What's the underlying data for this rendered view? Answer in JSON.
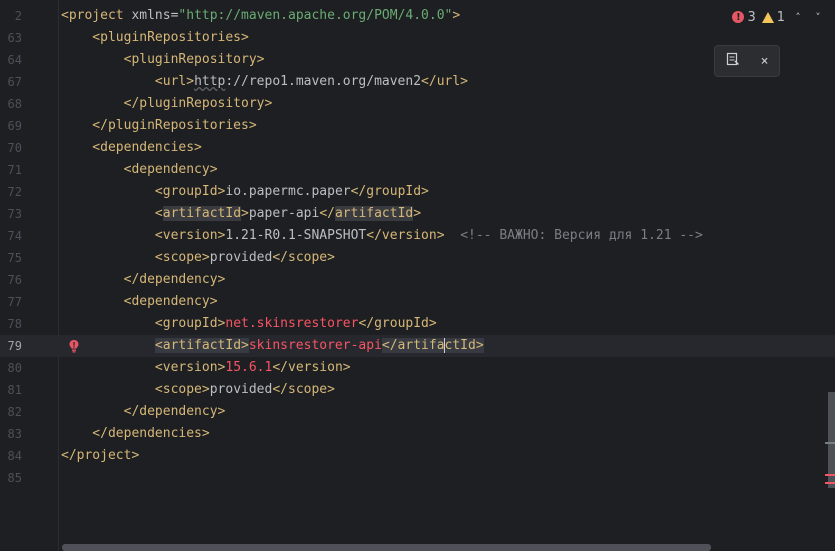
{
  "inspections": {
    "errors": "3",
    "warnings": "1",
    "prev": "˄",
    "next": "˅"
  },
  "popup": {
    "reader_icon": "reader-mode-icon",
    "close": "×"
  },
  "colors": {
    "tag": "#d5b778",
    "string": "#6aab73",
    "comment": "#7a7e85",
    "error": "#f75464"
  },
  "lines": [
    {
      "num": "2",
      "tokens": [
        {
          "t": "<project ",
          "c": "tag"
        },
        {
          "t": "xmlns",
          "c": "attr"
        },
        {
          "t": "=",
          "c": "text"
        },
        {
          "t": "\"http://maven.apache.org/POM/4.0.0\"",
          "c": "str"
        },
        {
          "t": ">",
          "c": "tag"
        }
      ]
    },
    {
      "num": "63",
      "tokens": [
        {
          "t": "    <pluginRepositories>",
          "c": "tag"
        }
      ]
    },
    {
      "num": "64",
      "tokens": [
        {
          "t": "        <pluginRepository>",
          "c": "tag"
        }
      ]
    },
    {
      "num": "67",
      "tokens": [
        {
          "t": "            ",
          "c": "text"
        },
        {
          "t": "<url>",
          "c": "tag"
        },
        {
          "t": "http",
          "c": "text",
          "squig": true
        },
        {
          "t": "://repo1.maven.org/maven2",
          "c": "text"
        },
        {
          "t": "</url>",
          "c": "tag"
        }
      ]
    },
    {
      "num": "68",
      "tokens": [
        {
          "t": "        </pluginRepository>",
          "c": "tag"
        }
      ]
    },
    {
      "num": "69",
      "tokens": [
        {
          "t": "    </pluginRepositories>",
          "c": "tag"
        }
      ]
    },
    {
      "num": "70",
      "tokens": [
        {
          "t": "    <dependencies>",
          "c": "tag"
        }
      ]
    },
    {
      "num": "71",
      "tokens": [
        {
          "t": "        <dependency>",
          "c": "tag"
        }
      ]
    },
    {
      "num": "72",
      "tokens": [
        {
          "t": "            ",
          "c": "text"
        },
        {
          "t": "<groupId>",
          "c": "tag"
        },
        {
          "t": "io.papermc.paper",
          "c": "text"
        },
        {
          "t": "</groupId>",
          "c": "tag"
        }
      ]
    },
    {
      "num": "73",
      "tokens": [
        {
          "t": "            ",
          "c": "text"
        },
        {
          "t": "<",
          "c": "tag"
        },
        {
          "t": "artifactId",
          "c": "tag",
          "ident": true
        },
        {
          "t": ">",
          "c": "tag"
        },
        {
          "t": "paper-api",
          "c": "text"
        },
        {
          "t": "</",
          "c": "tag"
        },
        {
          "t": "artifactId",
          "c": "tag",
          "ident": true
        },
        {
          "t": ">",
          "c": "tag"
        }
      ]
    },
    {
      "num": "74",
      "tokens": [
        {
          "t": "            ",
          "c": "text"
        },
        {
          "t": "<version>",
          "c": "tag"
        },
        {
          "t": "1.21-R0.1-SNAPSHOT",
          "c": "text"
        },
        {
          "t": "</version>",
          "c": "tag"
        },
        {
          "t": "  <!-- ВАЖНО: Версия для 1.21 -->",
          "c": "comment"
        }
      ]
    },
    {
      "num": "75",
      "tokens": [
        {
          "t": "            ",
          "c": "text"
        },
        {
          "t": "<scope>",
          "c": "tag"
        },
        {
          "t": "provided",
          "c": "text"
        },
        {
          "t": "</scope>",
          "c": "tag"
        }
      ]
    },
    {
      "num": "76",
      "tokens": [
        {
          "t": "        </dependency>",
          "c": "tag"
        }
      ]
    },
    {
      "num": "77",
      "tokens": [
        {
          "t": "        <dependency>",
          "c": "tag"
        }
      ]
    },
    {
      "num": "78",
      "tokens": [
        {
          "t": "            ",
          "c": "text"
        },
        {
          "t": "<groupId>",
          "c": "tag"
        },
        {
          "t": "net.skinsrestorer",
          "c": "err"
        },
        {
          "t": "</groupId>",
          "c": "tag"
        }
      ]
    },
    {
      "num": "79",
      "current": true,
      "error_icon": true,
      "tokens": [
        {
          "t": "            ",
          "c": "text"
        },
        {
          "t": "<artifactId>",
          "c": "tag",
          "hl": true
        },
        {
          "t": "skinsrestorer-api",
          "c": "err"
        },
        {
          "t": "</artifa",
          "c": "tag",
          "hl": true
        },
        {
          "caret": true
        },
        {
          "t": "ctId>",
          "c": "tag",
          "hl": true
        }
      ]
    },
    {
      "num": "80",
      "tokens": [
        {
          "t": "            ",
          "c": "text"
        },
        {
          "t": "<version>",
          "c": "tag"
        },
        {
          "t": "15.6.1",
          "c": "err"
        },
        {
          "t": "</version>",
          "c": "tag"
        }
      ]
    },
    {
      "num": "81",
      "tokens": [
        {
          "t": "            ",
          "c": "text"
        },
        {
          "t": "<scope>",
          "c": "tag"
        },
        {
          "t": "provided",
          "c": "text"
        },
        {
          "t": "</scope>",
          "c": "tag"
        }
      ]
    },
    {
      "num": "82",
      "tokens": [
        {
          "t": "        </dependency>",
          "c": "tag"
        }
      ]
    },
    {
      "num": "83",
      "tokens": [
        {
          "t": "    </dependencies>",
          "c": "tag"
        }
      ]
    },
    {
      "num": "84",
      "tokens": [
        {
          "t": "</project>",
          "c": "tag"
        }
      ]
    },
    {
      "num": "85",
      "tokens": []
    }
  ]
}
